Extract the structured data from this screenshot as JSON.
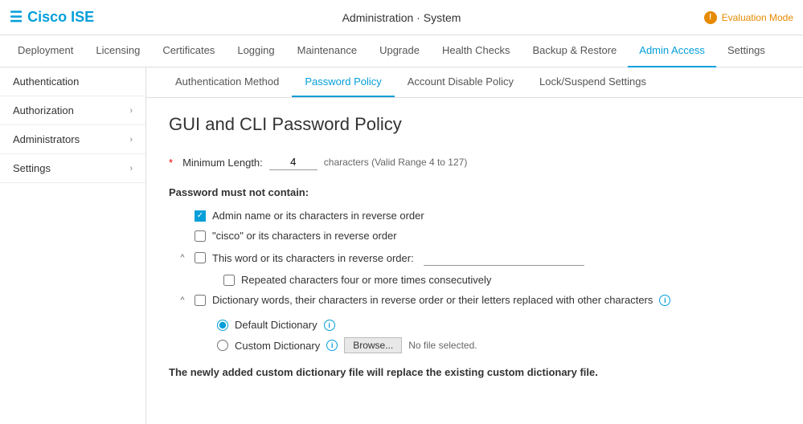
{
  "topbar": {
    "logo_text": "Cisco ISE",
    "breadcrumb": "Administration · System",
    "eval_mode": "Evaluation Mode"
  },
  "nav": {
    "tabs": [
      {
        "label": "Deployment",
        "active": false
      },
      {
        "label": "Licensing",
        "active": false
      },
      {
        "label": "Certificates",
        "active": false
      },
      {
        "label": "Logging",
        "active": false
      },
      {
        "label": "Maintenance",
        "active": false
      },
      {
        "label": "Upgrade",
        "active": false
      },
      {
        "label": "Health Checks",
        "active": false
      },
      {
        "label": "Backup & Restore",
        "active": false
      },
      {
        "label": "Admin Access",
        "active": true
      },
      {
        "label": "Settings",
        "active": false
      }
    ]
  },
  "sidebar": {
    "items": [
      {
        "label": "Authentication",
        "has_chevron": false,
        "active": false
      },
      {
        "label": "Authorization",
        "has_chevron": true,
        "active": false
      },
      {
        "label": "Administrators",
        "has_chevron": true,
        "active": false
      },
      {
        "label": "Settings",
        "has_chevron": true,
        "active": false
      }
    ]
  },
  "sub_tabs": {
    "tabs": [
      {
        "label": "Authentication Method",
        "active": false
      },
      {
        "label": "Password Policy",
        "active": true
      },
      {
        "label": "Account Disable Policy",
        "active": false
      },
      {
        "label": "Lock/Suspend Settings",
        "active": false
      }
    ]
  },
  "page": {
    "title": "GUI and CLI Password Policy",
    "min_length_label": "Minimum Length:",
    "min_length_value": "4",
    "min_length_hint": "characters (Valid Range 4 to 127)",
    "required_star": "*",
    "section_label": "Password must not contain:",
    "checkboxes": [
      {
        "label": "Admin name or its characters in reverse order",
        "checked": true,
        "has_caret": false,
        "has_word_input": false
      },
      {
        "label": "\"cisco\" or its characters in reverse order",
        "checked": false,
        "has_caret": false,
        "has_word_input": false
      },
      {
        "label": "This word or its characters in reverse order:",
        "checked": false,
        "has_caret": true,
        "has_word_input": true,
        "word_value": ""
      },
      {
        "label": "Repeated characters four or more times consecutively",
        "checked": false,
        "has_caret": false,
        "has_word_input": false
      },
      {
        "label": "Dictionary words, their characters in reverse order or their letters replaced with other characters",
        "checked": false,
        "has_caret": true,
        "has_word_input": false,
        "has_info": true
      }
    ],
    "dictionary": {
      "default_label": "Default Dictionary",
      "custom_label": "Custom Dictionary",
      "browse_btn": "Browse...",
      "no_file": "No file selected."
    },
    "footer_note": "The newly added custom dictionary file will replace the existing custom dictionary file."
  }
}
